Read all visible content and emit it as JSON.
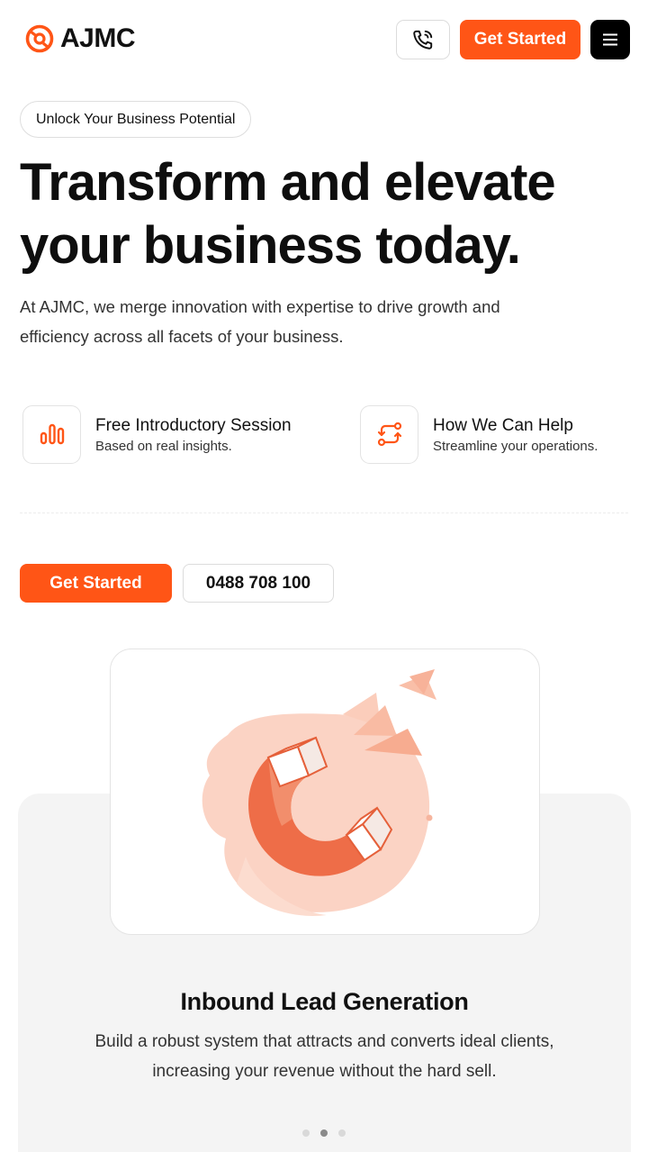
{
  "brand": {
    "name": "AJMC",
    "accent": "#ff5516"
  },
  "header": {
    "call_icon": "phone-icon",
    "get_started_label": "Get Started",
    "menu_icon": "hamburger-menu-icon"
  },
  "hero": {
    "badge": "Unlock Your Business Potential",
    "title_line1": "Transform and elevate",
    "title_line2": "your business today.",
    "description": "At AJMC, we merge innovation with expertise to drive growth and efficiency across all facets of your business."
  },
  "features": [
    {
      "icon": "bar-chart-icon",
      "title": "Free Introductory Session",
      "subtitle": "Based on real insights."
    },
    {
      "icon": "route-arrows-icon",
      "title": "How We Can Help",
      "subtitle": "Streamline your operations."
    }
  ],
  "cta": {
    "primary_label": "Get Started",
    "phone_label": "0488 708 100"
  },
  "service": {
    "illustration": "magnet-icon",
    "title": "Inbound Lead Generation",
    "description": "Build a robust system that attracts and converts ideal clients, increasing your revenue without the hard sell.",
    "carousel_dots": 3,
    "active_dot": 2
  }
}
